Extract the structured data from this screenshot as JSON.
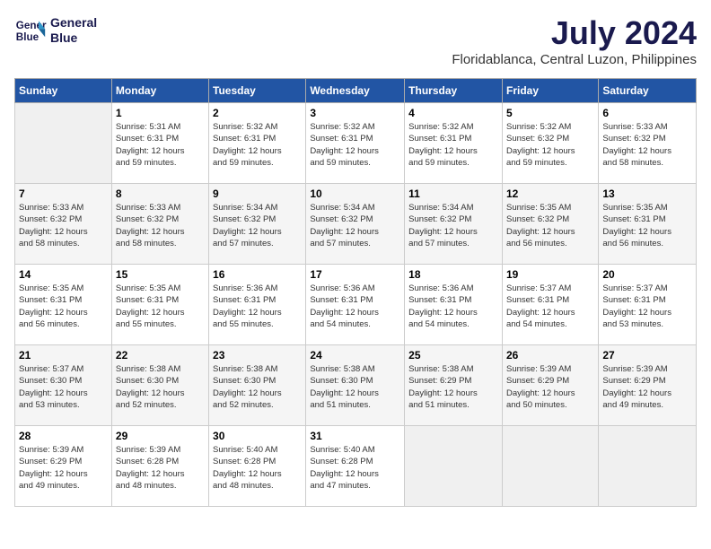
{
  "header": {
    "logo_line1": "General",
    "logo_line2": "Blue",
    "month_title": "July 2024",
    "subtitle": "Floridablanca, Central Luzon, Philippines"
  },
  "calendar": {
    "days_of_week": [
      "Sunday",
      "Monday",
      "Tuesday",
      "Wednesday",
      "Thursday",
      "Friday",
      "Saturday"
    ],
    "weeks": [
      [
        {
          "day": "",
          "info": ""
        },
        {
          "day": "1",
          "info": "Sunrise: 5:31 AM\nSunset: 6:31 PM\nDaylight: 12 hours\nand 59 minutes."
        },
        {
          "day": "2",
          "info": "Sunrise: 5:32 AM\nSunset: 6:31 PM\nDaylight: 12 hours\nand 59 minutes."
        },
        {
          "day": "3",
          "info": "Sunrise: 5:32 AM\nSunset: 6:31 PM\nDaylight: 12 hours\nand 59 minutes."
        },
        {
          "day": "4",
          "info": "Sunrise: 5:32 AM\nSunset: 6:31 PM\nDaylight: 12 hours\nand 59 minutes."
        },
        {
          "day": "5",
          "info": "Sunrise: 5:32 AM\nSunset: 6:32 PM\nDaylight: 12 hours\nand 59 minutes."
        },
        {
          "day": "6",
          "info": "Sunrise: 5:33 AM\nSunset: 6:32 PM\nDaylight: 12 hours\nand 58 minutes."
        }
      ],
      [
        {
          "day": "7",
          "info": "Sunrise: 5:33 AM\nSunset: 6:32 PM\nDaylight: 12 hours\nand 58 minutes."
        },
        {
          "day": "8",
          "info": "Sunrise: 5:33 AM\nSunset: 6:32 PM\nDaylight: 12 hours\nand 58 minutes."
        },
        {
          "day": "9",
          "info": "Sunrise: 5:34 AM\nSunset: 6:32 PM\nDaylight: 12 hours\nand 57 minutes."
        },
        {
          "day": "10",
          "info": "Sunrise: 5:34 AM\nSunset: 6:32 PM\nDaylight: 12 hours\nand 57 minutes."
        },
        {
          "day": "11",
          "info": "Sunrise: 5:34 AM\nSunset: 6:32 PM\nDaylight: 12 hours\nand 57 minutes."
        },
        {
          "day": "12",
          "info": "Sunrise: 5:35 AM\nSunset: 6:32 PM\nDaylight: 12 hours\nand 56 minutes."
        },
        {
          "day": "13",
          "info": "Sunrise: 5:35 AM\nSunset: 6:31 PM\nDaylight: 12 hours\nand 56 minutes."
        }
      ],
      [
        {
          "day": "14",
          "info": "Sunrise: 5:35 AM\nSunset: 6:31 PM\nDaylight: 12 hours\nand 56 minutes."
        },
        {
          "day": "15",
          "info": "Sunrise: 5:35 AM\nSunset: 6:31 PM\nDaylight: 12 hours\nand 55 minutes."
        },
        {
          "day": "16",
          "info": "Sunrise: 5:36 AM\nSunset: 6:31 PM\nDaylight: 12 hours\nand 55 minutes."
        },
        {
          "day": "17",
          "info": "Sunrise: 5:36 AM\nSunset: 6:31 PM\nDaylight: 12 hours\nand 54 minutes."
        },
        {
          "day": "18",
          "info": "Sunrise: 5:36 AM\nSunset: 6:31 PM\nDaylight: 12 hours\nand 54 minutes."
        },
        {
          "day": "19",
          "info": "Sunrise: 5:37 AM\nSunset: 6:31 PM\nDaylight: 12 hours\nand 54 minutes."
        },
        {
          "day": "20",
          "info": "Sunrise: 5:37 AM\nSunset: 6:31 PM\nDaylight: 12 hours\nand 53 minutes."
        }
      ],
      [
        {
          "day": "21",
          "info": "Sunrise: 5:37 AM\nSunset: 6:30 PM\nDaylight: 12 hours\nand 53 minutes."
        },
        {
          "day": "22",
          "info": "Sunrise: 5:38 AM\nSunset: 6:30 PM\nDaylight: 12 hours\nand 52 minutes."
        },
        {
          "day": "23",
          "info": "Sunrise: 5:38 AM\nSunset: 6:30 PM\nDaylight: 12 hours\nand 52 minutes."
        },
        {
          "day": "24",
          "info": "Sunrise: 5:38 AM\nSunset: 6:30 PM\nDaylight: 12 hours\nand 51 minutes."
        },
        {
          "day": "25",
          "info": "Sunrise: 5:38 AM\nSunset: 6:29 PM\nDaylight: 12 hours\nand 51 minutes."
        },
        {
          "day": "26",
          "info": "Sunrise: 5:39 AM\nSunset: 6:29 PM\nDaylight: 12 hours\nand 50 minutes."
        },
        {
          "day": "27",
          "info": "Sunrise: 5:39 AM\nSunset: 6:29 PM\nDaylight: 12 hours\nand 49 minutes."
        }
      ],
      [
        {
          "day": "28",
          "info": "Sunrise: 5:39 AM\nSunset: 6:29 PM\nDaylight: 12 hours\nand 49 minutes."
        },
        {
          "day": "29",
          "info": "Sunrise: 5:39 AM\nSunset: 6:28 PM\nDaylight: 12 hours\nand 48 minutes."
        },
        {
          "day": "30",
          "info": "Sunrise: 5:40 AM\nSunset: 6:28 PM\nDaylight: 12 hours\nand 48 minutes."
        },
        {
          "day": "31",
          "info": "Sunrise: 5:40 AM\nSunset: 6:28 PM\nDaylight: 12 hours\nand 47 minutes."
        },
        {
          "day": "",
          "info": ""
        },
        {
          "day": "",
          "info": ""
        },
        {
          "day": "",
          "info": ""
        }
      ]
    ]
  }
}
